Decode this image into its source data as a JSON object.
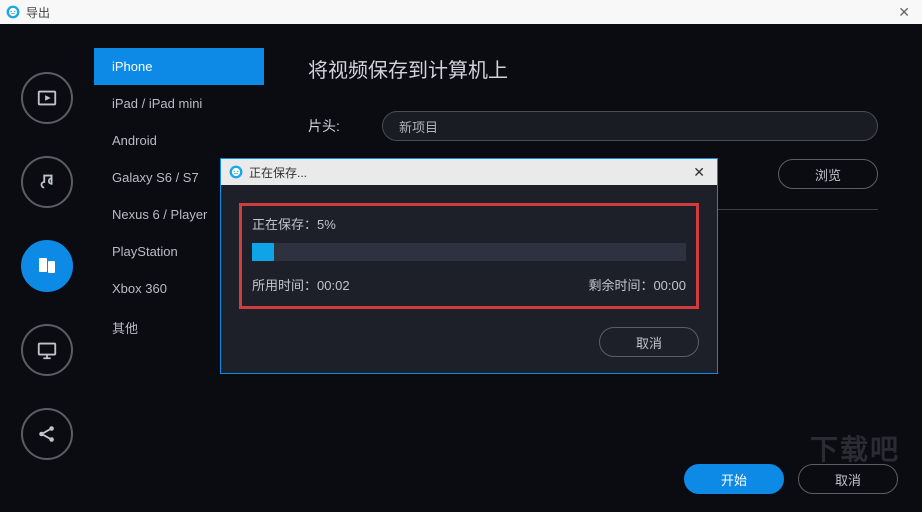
{
  "window": {
    "title": "导出"
  },
  "sidebar": {
    "icons": [
      "play",
      "music",
      "tablet",
      "monitor",
      "share"
    ],
    "active_index": 2
  },
  "devices": {
    "items": [
      {
        "label": "iPhone"
      },
      {
        "label": "iPad / iPad mini"
      },
      {
        "label": "Android"
      },
      {
        "label": "Galaxy S6 / S7"
      },
      {
        "label": "Nexus 6 / Player"
      },
      {
        "label": "PlayStation"
      },
      {
        "label": "Xbox 360"
      },
      {
        "label": "其他"
      }
    ],
    "selected_index": 0
  },
  "content": {
    "heading": "将视频保存到计算机上",
    "title_label": "片头:",
    "title_value": "新项目",
    "browse": "浏览"
  },
  "footer": {
    "start": "开始",
    "cancel": "取消"
  },
  "watermark": "下载吧",
  "dialog": {
    "title": "正在保存...",
    "progress_label": "正在保存：",
    "progress_percent": "5%",
    "progress_value": 5,
    "elapsed_label": "所用时间：",
    "elapsed_value": "00:02",
    "remain_label": "剩余时间：",
    "remain_value": "00:00",
    "cancel": "取消"
  }
}
